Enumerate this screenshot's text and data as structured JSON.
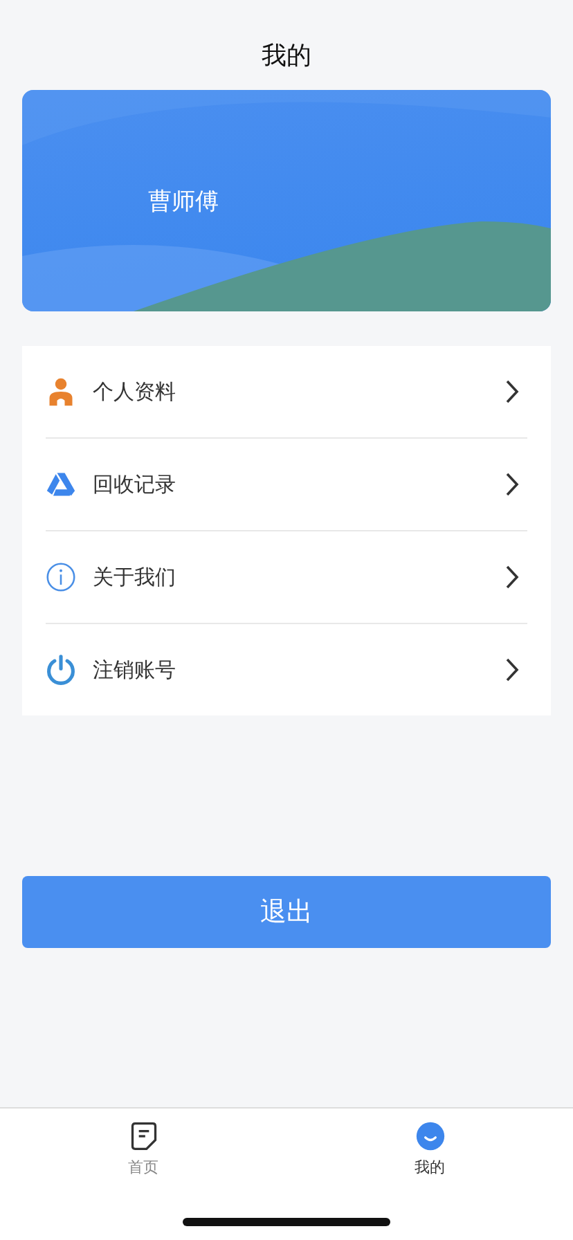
{
  "header": {
    "title": "我的"
  },
  "profile_card": {
    "name": "曹师傅"
  },
  "menu": [
    {
      "kind": "person",
      "label": "个人资料"
    },
    {
      "kind": "recycle",
      "label": "回收记录"
    },
    {
      "kind": "info",
      "label": "关于我们"
    },
    {
      "kind": "power",
      "label": "注销账号"
    }
  ],
  "logout_button": {
    "label": "退出"
  },
  "tab_bar": [
    {
      "kind": "home",
      "label": "首页",
      "selected": false
    },
    {
      "kind": "me",
      "label": "我的",
      "selected": true
    }
  ]
}
